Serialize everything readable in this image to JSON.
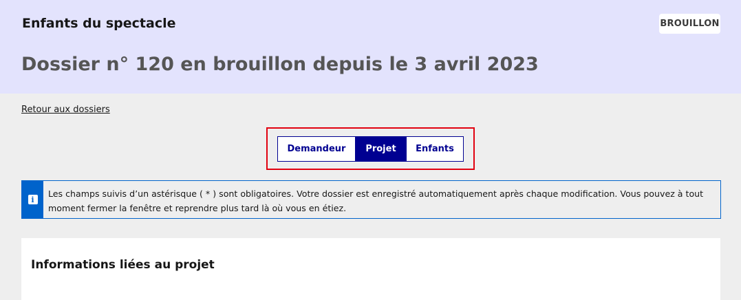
{
  "header": {
    "app_title": "Enfants du spectacle",
    "status_badge": "BROUILLON",
    "dossier_title": "Dossier n° 120 en brouillon depuis le 3 avril 2023"
  },
  "nav": {
    "back_link": "Retour aux dossiers"
  },
  "tabs": [
    {
      "label": "Demandeur",
      "active": false
    },
    {
      "label": "Projet",
      "active": true
    },
    {
      "label": "Enfants",
      "active": false
    }
  ],
  "notice": {
    "icon": "info-icon",
    "icon_glyph": "i",
    "text": "Les champs suivis d’un astérisque ( * ) sont obligatoires. Votre dossier est enregistré automatiquement après chaque modification. Vous pouvez à tout moment fermer la fenêtre et reprendre plus tard là où vous en étiez."
  },
  "section": {
    "title": "Informations liées au projet"
  },
  "colors": {
    "header_bg": "#e3e3fd",
    "accent": "#000091",
    "info": "#0063cb",
    "highlight": "#e1000f"
  }
}
